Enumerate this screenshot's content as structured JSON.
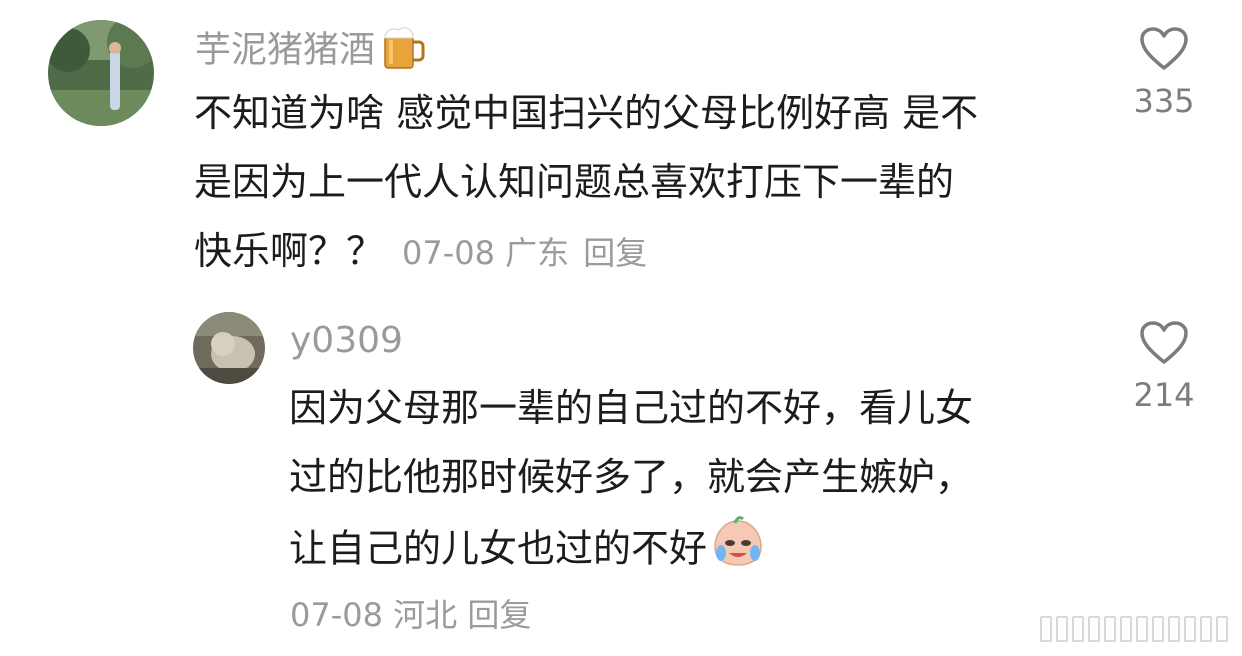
{
  "comments": [
    {
      "username": "芋泥猪猪酒",
      "username_emoji": "beer-mug-icon",
      "text_lines": [
        "不知道为啥 感觉中国扫兴的父母比例好高 是不",
        "是因为上一代人认知问题总喜欢打压下一辈的",
        "快乐啊？？"
      ],
      "date": "07-08",
      "location": "广东",
      "reply_label": "回复",
      "likes": "335"
    },
    {
      "username": "y0309",
      "text_lines": [
        "因为父母那一辈的自己过的不好，看儿女",
        "过的比他那时候好多了，就会产生嫉妒，",
        "让自己的儿女也过的不好"
      ],
      "trailing_emoji": "crying-face-emoji",
      "date": "07-08",
      "location": "河北",
      "reply_label": "回复",
      "likes": "214"
    }
  ],
  "colors": {
    "username": "#9a9a9a",
    "text": "#1c1c1c",
    "meta": "#9b9b9b",
    "like_icon": "#7c7c7c"
  }
}
